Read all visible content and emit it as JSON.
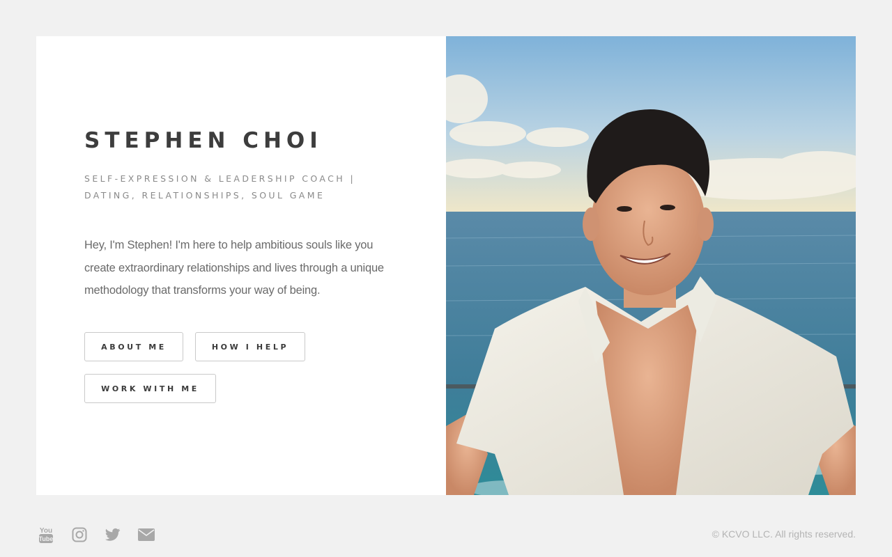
{
  "profile": {
    "name": "STEPHEN CHOI",
    "subtitle_line1": "SELF-EXPRESSION & LEADERSHIP COACH |",
    "subtitle_line2": "DATING, RELATIONSHIPS, SOUL GAME",
    "intro": "Hey, I'm Stephen! I'm here to help ambitious souls like you create extraordinary relationships and lives through a unique methodology that transforms your way of being."
  },
  "buttons": {
    "about": "ABOUT ME",
    "help": "HOW I HELP",
    "work": "WORK WITH ME"
  },
  "footer": {
    "icons": [
      "youtube-icon",
      "instagram-icon",
      "twitter-icon",
      "email-icon"
    ],
    "youtube_glyph": "You\nTube",
    "copyright": "© KCVO LLC. All rights reserved."
  },
  "colors": {
    "background": "#f1f1f1",
    "card": "#ffffff",
    "heading": "#3d3d3d",
    "subtitle": "#8a8a8a",
    "body_text": "#6a6a6a",
    "icon": "#a8a8a8"
  }
}
